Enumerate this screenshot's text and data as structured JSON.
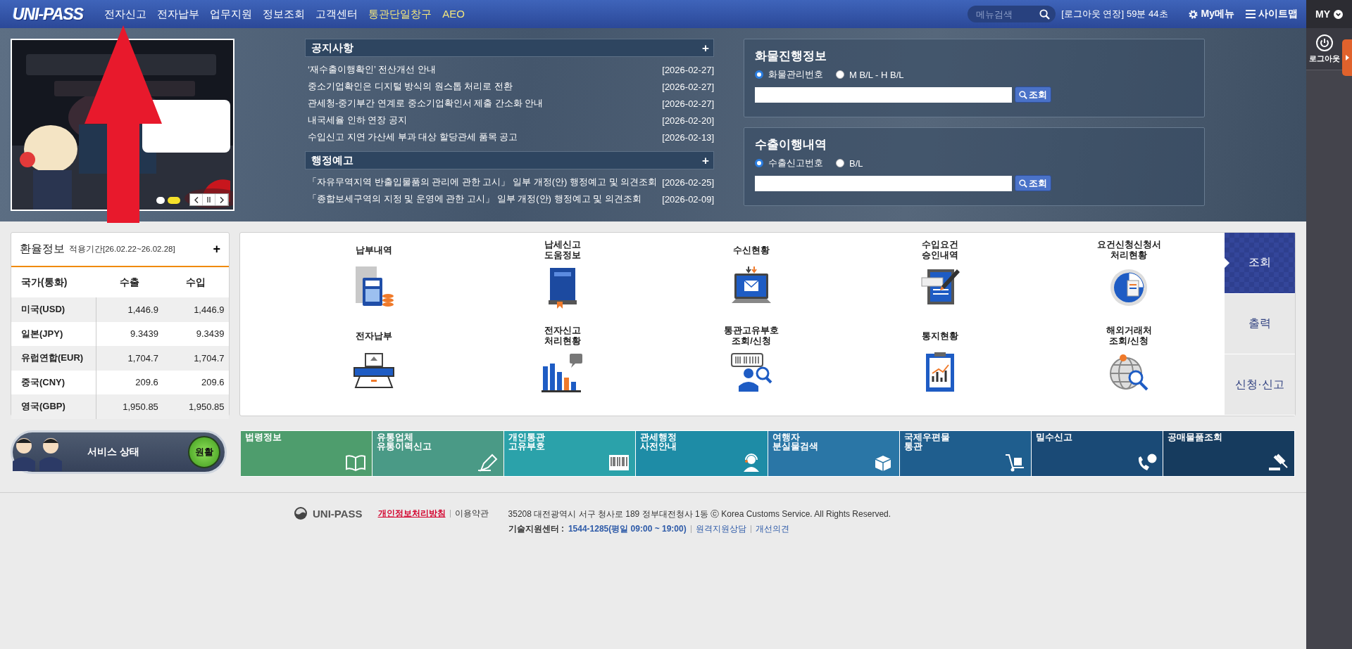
{
  "top_nav": {
    "logo": "UNI-PASS",
    "menu": [
      {
        "label": "전자신고",
        "accent": false
      },
      {
        "label": "전자납부",
        "accent": false
      },
      {
        "label": "업무지원",
        "accent": false
      },
      {
        "label": "정보조회",
        "accent": false
      },
      {
        "label": "고객센터",
        "accent": false
      },
      {
        "label": "통관단일창구",
        "accent": true
      },
      {
        "label": "AEO",
        "accent": true
      }
    ],
    "menu_search": {
      "placeholder": "메뉴검색"
    },
    "session_extend": "[로그아웃 연장]",
    "session_time": "59분 44초",
    "my_menu": "My메뉴",
    "sitemap": "사이트맵"
  },
  "side_rail": {
    "my": "MY",
    "logout": "로그아웃"
  },
  "banner": {
    "kind": "picture",
    "dots": [
      {
        "selected": false
      },
      {
        "selected": true
      }
    ]
  },
  "notices": {
    "title": "공지사항",
    "more": "+",
    "items": [
      {
        "title": "‘재수출이행확인’ 전산개선 안내",
        "date": "[2026-02-27]"
      },
      {
        "title": "중소기업확인은 디지털 방식의 원스톱 처리로 전환",
        "date": "[2026-02-27]"
      },
      {
        "title": "관세청-중기부간 연계로 중소기업확인서 제출 간소화 안내",
        "date": "[2026-02-27]"
      },
      {
        "title": "내국세율 인하 연장 공지",
        "date": "[2026-02-20]"
      },
      {
        "title": "수입신고 지연 가산세 부과 대상 할당관세 품목 공고",
        "date": "[2026-02-13]"
      }
    ]
  },
  "admin_notices": {
    "title": "행정예고",
    "more": "+",
    "items": [
      {
        "title": "「자유무역지역 반출입물품의 관리에 관한 고시」 일부 개정(안) 행정예고 및 의견조회",
        "date": "[2026-02-25]"
      },
      {
        "title": "「종합보세구역의 지정 및 운영에 관한 고시」 일부 개정(안) 행정예고 및 의견조회",
        "date": "[2026-02-09]"
      }
    ]
  },
  "lookups": [
    {
      "title": "화물진행정보",
      "options": [
        {
          "label": "화물관리번호",
          "selected": true
        },
        {
          "label": "M B/L - H B/L",
          "selected": false
        }
      ],
      "button": "조회"
    },
    {
      "title": "수출이행내역",
      "options": [
        {
          "label": "수출신고번호",
          "selected": true
        },
        {
          "label": "B/L",
          "selected": false
        }
      ],
      "button": "조회"
    }
  ],
  "exchange": {
    "title": "환율정보",
    "period": "적용기간[26.02.22~26.02.28]",
    "more": "+",
    "columns": [
      "국가(통화)",
      "수출",
      "수입"
    ],
    "rows": [
      [
        "미국(USD)",
        "1,446.9",
        "1,446.9"
      ],
      [
        "일본(JPY)",
        "9.3439",
        "9.3439"
      ],
      [
        "유럽연합(EUR)",
        "1,704.7",
        "1,704.7"
      ],
      [
        "중국(CNY)",
        "209.6",
        "209.6"
      ],
      [
        "영국(GBP)",
        "1,950.85",
        "1,950.85"
      ]
    ]
  },
  "services": [
    {
      "lines": [
        "납부내역"
      ],
      "kind": "payment"
    },
    {
      "lines": [
        "납세신고",
        "도움정보"
      ],
      "kind": "help"
    },
    {
      "lines": [
        "수신현황"
      ],
      "kind": "receive"
    },
    {
      "lines": [
        "수입요건",
        "승인내역"
      ],
      "kind": "import"
    },
    {
      "lines": [
        "요건신청신청서",
        "처리현황"
      ],
      "kind": "pie"
    },
    {
      "lines": [
        "전자납부"
      ],
      "kind": "epay"
    },
    {
      "lines": [
        "전자신고",
        "처리현황"
      ],
      "kind": "chart"
    },
    {
      "lines": [
        "통관고유부호",
        "조회/신청"
      ],
      "kind": "barcode"
    },
    {
      "lines": [
        "통지현황"
      ],
      "kind": "notice"
    },
    {
      "lines": [
        "해외거래처",
        "조회/신청"
      ],
      "kind": "globe"
    }
  ],
  "service_tabs": [
    {
      "label": "조회",
      "selected": true
    },
    {
      "label": "출력",
      "selected": false
    },
    {
      "label": "신청·신고",
      "selected": false
    }
  ],
  "service_status": {
    "label": "서비스 상태",
    "status": "원활"
  },
  "quick_links": [
    {
      "lines": [
        "법령정보"
      ],
      "color": "#4e9d6d",
      "kind": "book"
    },
    {
      "lines": [
        "유통업체",
        "유통이력신고"
      ],
      "color": "#4a9a86",
      "kind": "pen"
    },
    {
      "lines": [
        "개인통관",
        "고유부호"
      ],
      "color": "#2ba2aa",
      "kind": "barcode"
    },
    {
      "lines": [
        "관세행정",
        "사전안내"
      ],
      "color": "#1e8ca6",
      "kind": "person"
    },
    {
      "lines": [
        "여행자",
        "분실물검색"
      ],
      "color": "#2a76a6",
      "kind": "box"
    },
    {
      "lines": [
        "국제우편물",
        "통관"
      ],
      "color": "#1f5e8e",
      "kind": "cart"
    },
    {
      "lines": [
        "밀수신고"
      ],
      "color": "#1a4a76",
      "kind": "phone"
    },
    {
      "lines": [
        "공매물품조회"
      ],
      "color": "#163b5e",
      "kind": "gavel"
    }
  ],
  "footer": {
    "brand": "UNI-PASS",
    "links": [
      {
        "label": "개인정보처리방침",
        "kind": "privacy"
      },
      {
        "label": "이용약관",
        "kind": "normal"
      }
    ],
    "address": "35208 대전광역시 서구 청사로 189 정부대전청사 1동 ⓒ Korea Customs Service. All Rights Reserved.",
    "support_label": "기술지원센터 :",
    "support_phone": "1544-1285(평일 09:00 ~ 19:00)",
    "support_links": [
      "원격지원상담",
      "개선의견"
    ]
  }
}
